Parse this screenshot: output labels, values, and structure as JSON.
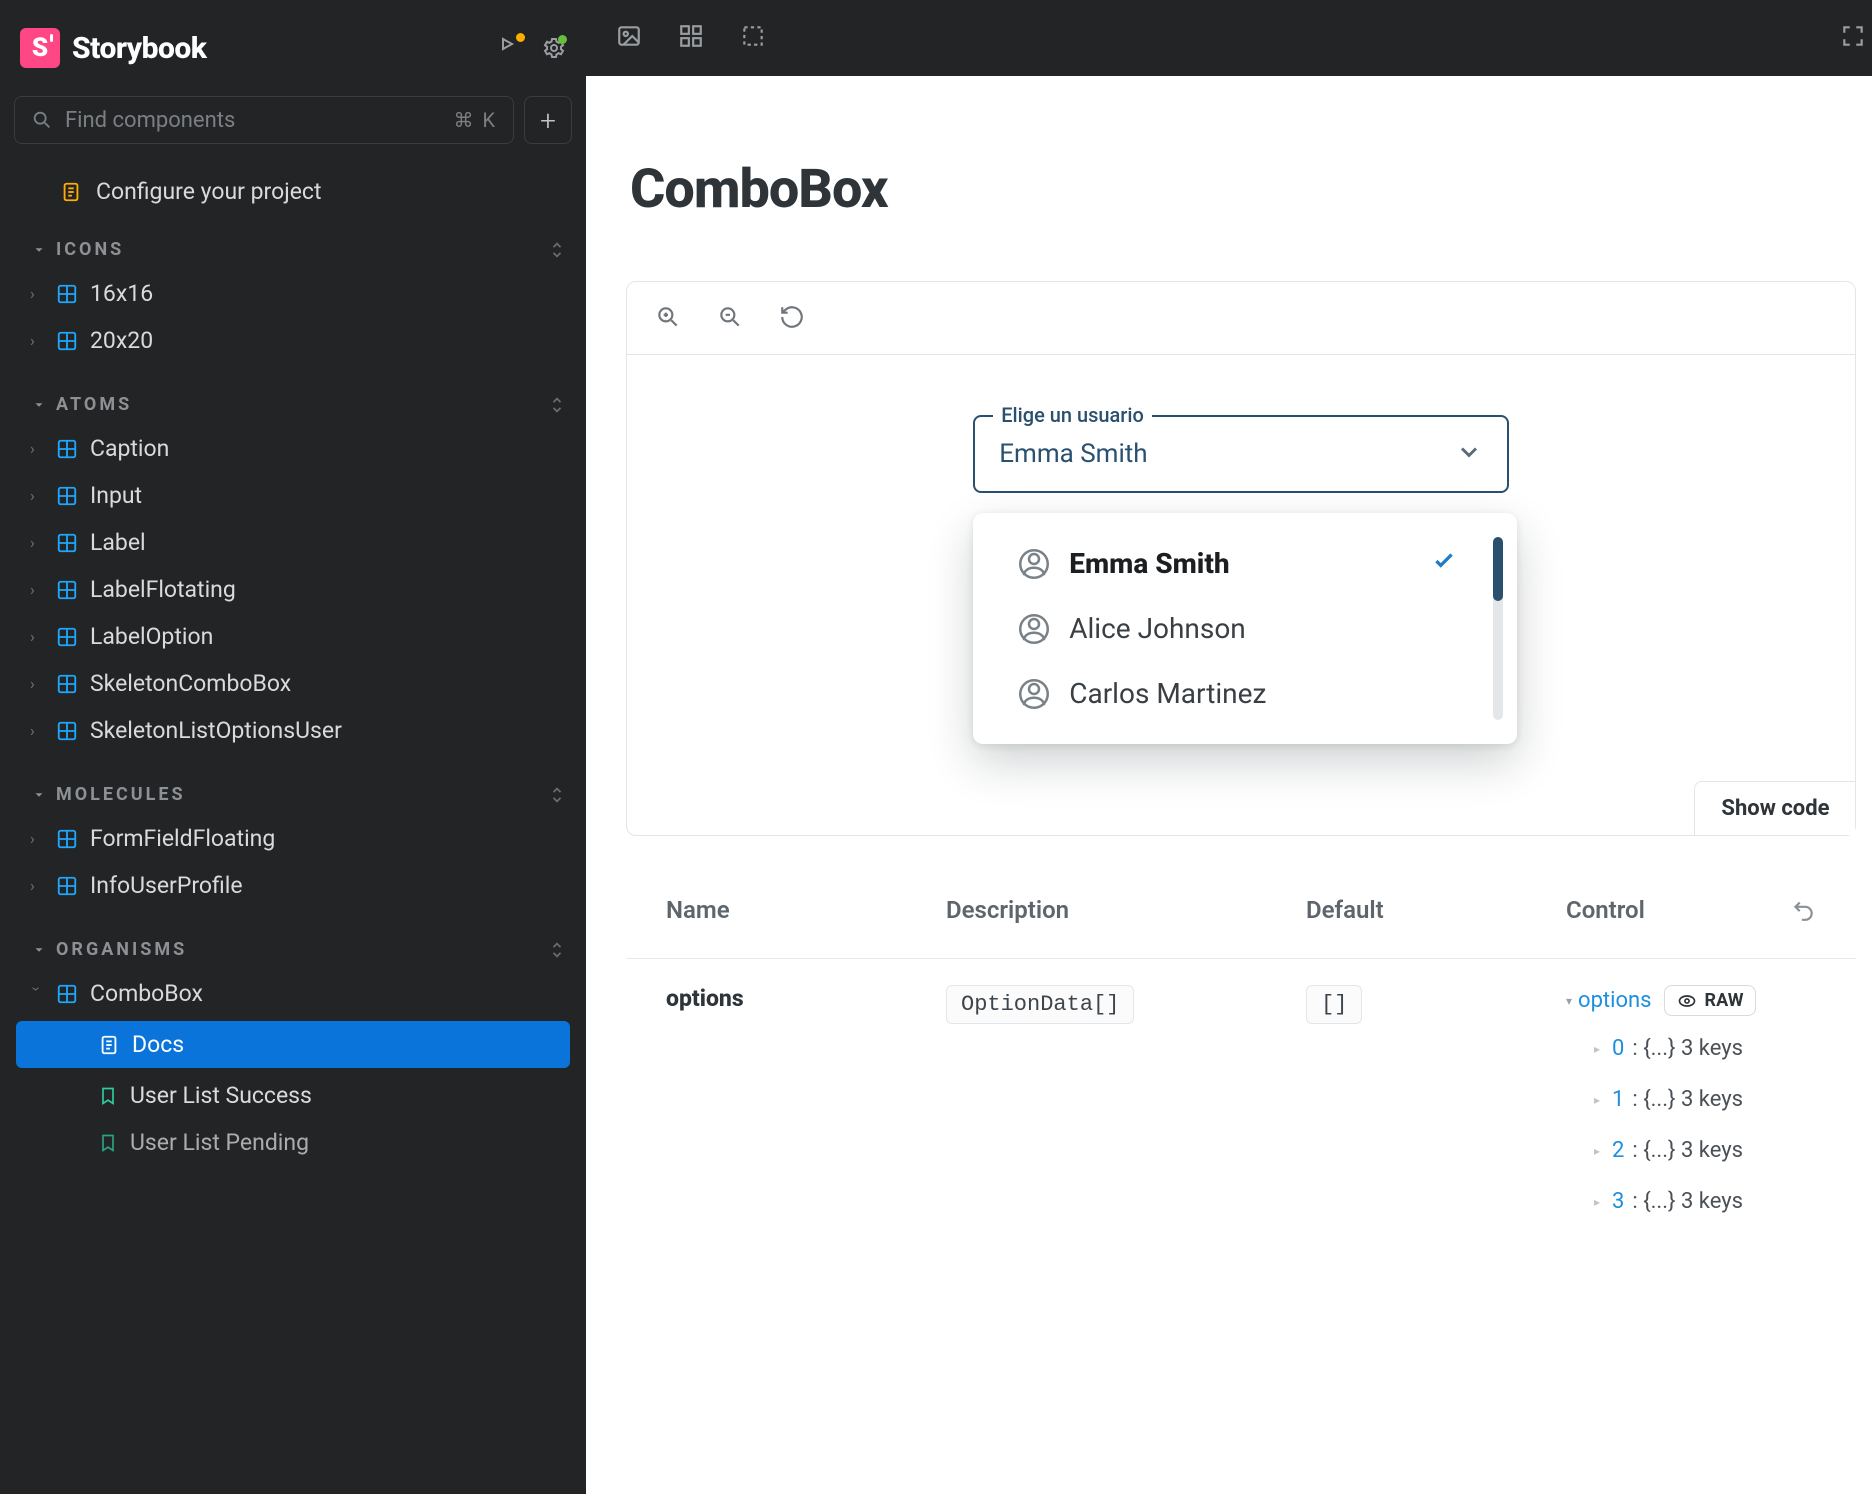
{
  "app": {
    "name": "Storybook",
    "logo_letter": "S"
  },
  "search": {
    "placeholder": "Find components",
    "shortcut": "⌘ K"
  },
  "top_item": {
    "label": "Configure your project"
  },
  "sections": {
    "icons": {
      "title": "ICONS",
      "items": [
        {
          "label": "16x16"
        },
        {
          "label": "20x20"
        }
      ]
    },
    "atoms": {
      "title": "ATOMS",
      "items": [
        {
          "label": "Caption"
        },
        {
          "label": "Input"
        },
        {
          "label": "Label"
        },
        {
          "label": "LabelFlotating"
        },
        {
          "label": "LabelOption"
        },
        {
          "label": "SkeletonComboBox"
        },
        {
          "label": "SkeletonListOptionsUser"
        }
      ]
    },
    "molecules": {
      "title": "MOLECULES",
      "items": [
        {
          "label": "FormFieldFloating"
        },
        {
          "label": "InfoUserProfile"
        }
      ]
    },
    "organisms": {
      "title": "ORGANISMS",
      "items": [
        {
          "label": "ComboBox",
          "expanded": true
        }
      ],
      "combobox_children": [
        {
          "label": "Docs",
          "active": true,
          "type": "doc"
        },
        {
          "label": "User List Success",
          "type": "story"
        },
        {
          "label": "User List Pending",
          "type": "story"
        }
      ]
    }
  },
  "page": {
    "title": "ComboBox"
  },
  "preview": {
    "combo": {
      "float_label": "Elige un usuario",
      "value": "Emma Smith"
    },
    "options": [
      {
        "label": "Emma Smith",
        "selected": true
      },
      {
        "label": "Alice Johnson",
        "selected": false
      },
      {
        "label": "Carlos Martinez",
        "selected": false
      }
    ],
    "show_code_label": "Show code"
  },
  "args": {
    "headers": {
      "name": "Name",
      "description": "Description",
      "default": "Default",
      "control": "Control"
    },
    "row": {
      "name": "options",
      "type": "OptionData[]",
      "default": "[]",
      "control_label": "options",
      "raw_label": "RAW",
      "items": [
        {
          "idx": "0",
          "suffix": " : {...} 3 keys"
        },
        {
          "idx": "1",
          "suffix": " : {...} 3 keys"
        },
        {
          "idx": "2",
          "suffix": " : {...} 3 keys"
        },
        {
          "idx": "3",
          "suffix": " : {...} 3 keys"
        }
      ]
    }
  }
}
